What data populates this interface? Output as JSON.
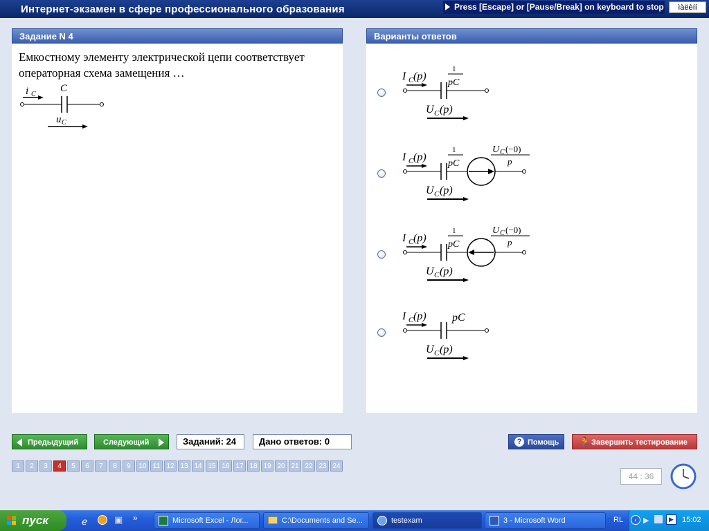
{
  "app": {
    "title": "Интернет-экзамен в сфере профессионального образования",
    "hint": "Press [Escape] or [Pause/Break] on keyboard to stop",
    "lang_indicator": "ìàëèíí"
  },
  "question": {
    "header": "Задание N 4",
    "text": "Емкостному элементу электрической цепи соответствует операторная схема замещения …",
    "labels": {
      "current": "i",
      "current_sub": "C",
      "cap": "C",
      "voltage": "u",
      "voltage_sub": "C"
    }
  },
  "answers": {
    "header": "Варианты ответов",
    "common": {
      "I": "I",
      "Isub": "C",
      "Ip": "(p)",
      "U": "U",
      "Usub": "C",
      "Up": "(p)"
    },
    "options": [
      {
        "numerator": "1",
        "denominator": "pC"
      },
      {
        "numerator": "1",
        "denominator": "pC",
        "src_num": "U",
        "src_sub": "C",
        "src_arg": "(−0)",
        "src_den": "p"
      },
      {
        "numerator": "1",
        "denominator": "pC",
        "src_num": "U",
        "src_sub": "C",
        "src_arg": "(−0)",
        "src_den": "p"
      },
      {
        "label": "pC"
      }
    ]
  },
  "nav": {
    "prev_label": "Предыдущий",
    "next_label": "Следующий",
    "total_label": "Заданий: 24",
    "answered_label": "Дано ответов: 0",
    "help_label": "Помощь",
    "finish_label": "Завершить тестирование"
  },
  "pages": {
    "numbers": [
      "1",
      "2",
      "3",
      "4",
      "5",
      "6",
      "7",
      "8",
      "9",
      "10",
      "11",
      "12",
      "13",
      "14",
      "15",
      "16",
      "17",
      "18",
      "19",
      "20",
      "21",
      "22",
      "23",
      "24"
    ],
    "current": 4
  },
  "timer": {
    "value": "44 : 36"
  },
  "taskbar": {
    "start_label": "пуск",
    "items": [
      {
        "label": "Microsoft Excel - Лог..."
      },
      {
        "label": "C:\\Documents and Se..."
      },
      {
        "label": "testexam"
      },
      {
        "label": "3 - Microsoft Word"
      }
    ],
    "lang": "RL",
    "time": "15:02"
  },
  "colors": {
    "title_bg": "#0b2768",
    "panel_header": "#3b5fb0",
    "nav_green": "#2f8a2f",
    "finish_red": "#b63a3a",
    "active_page": "#c4312b"
  }
}
